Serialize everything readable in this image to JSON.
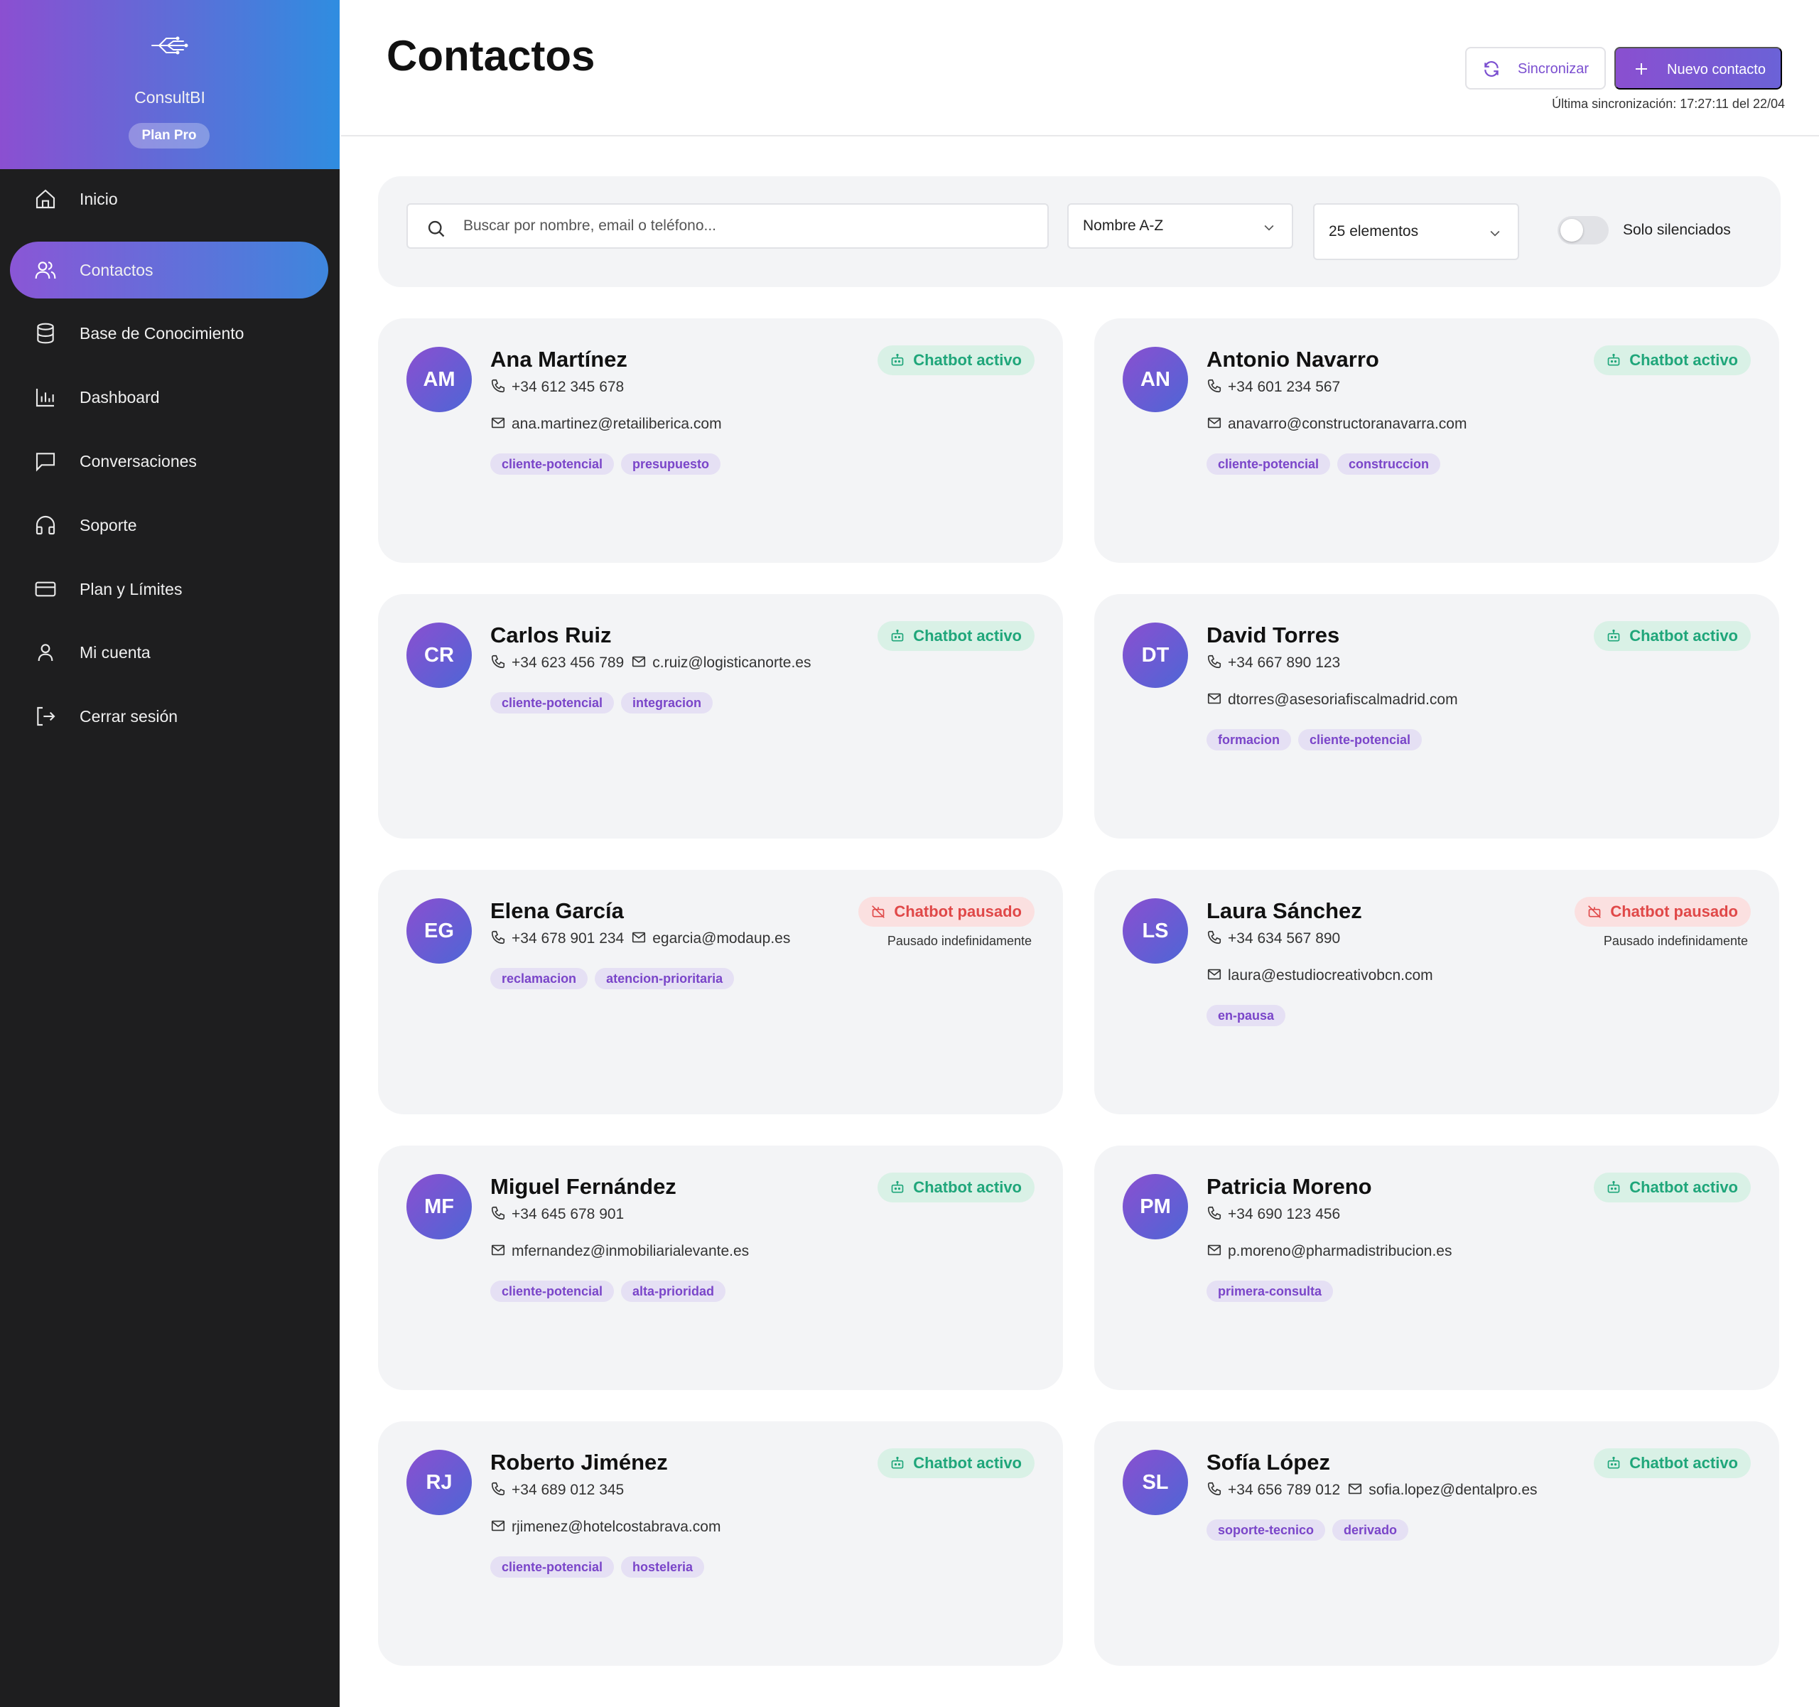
{
  "brand": {
    "name": "ConsultBI",
    "plan": "Plan Pro"
  },
  "nav": [
    {
      "label": "Inicio",
      "icon": "home-icon"
    },
    {
      "label": "Contactos",
      "icon": "users-icon"
    },
    {
      "label": "Base de Conocimiento",
      "icon": "database-icon"
    },
    {
      "label": "Dashboard",
      "icon": "bar-chart-icon"
    },
    {
      "label": "Conversaciones",
      "icon": "message-icon"
    },
    {
      "label": "Soporte",
      "icon": "headphones-icon"
    },
    {
      "label": "Plan y Límites",
      "icon": "credit-card-icon"
    },
    {
      "label": "Mi cuenta",
      "icon": "user-icon"
    },
    {
      "label": "Cerrar sesión",
      "icon": "logout-icon"
    }
  ],
  "header": {
    "title": "Contactos",
    "sync_label": "Sincronizar",
    "new_label": "Nuevo contacto",
    "last_sync": "Última sincronización: 17:27:11 del 22/04"
  },
  "filters": {
    "search_placeholder": "Buscar por nombre, email o teléfono...",
    "sort": "Nombre A-Z",
    "page_size": "25 elementos",
    "muted_label": "Solo silenciados"
  },
  "status_labels": {
    "active": "Chatbot activo",
    "paused": "Chatbot pausado"
  },
  "colors": {
    "accent": "#7b4fd0",
    "active": "#1fa67a",
    "paused": "#e04848",
    "sidebar": "#1e1e1f"
  },
  "contacts": [
    {
      "initials": "AM",
      "name": "Ana Martínez",
      "phone": "+34 612 345 678",
      "email": "ana.martinez@retailiberica.com",
      "inline": false,
      "status": "Chatbot activo",
      "state": "active",
      "note": "",
      "tags": [
        "cliente-potencial",
        "presupuesto"
      ]
    },
    {
      "initials": "AN",
      "name": "Antonio Navarro",
      "phone": "+34 601 234 567",
      "email": "anavarro@constructoranavarra.com",
      "inline": false,
      "status": "Chatbot activo",
      "state": "active",
      "note": "",
      "tags": [
        "cliente-potencial",
        "construccion"
      ]
    },
    {
      "initials": "CR",
      "name": "Carlos Ruiz",
      "phone": "+34 623 456 789",
      "email": "c.ruiz@logisticanorte.es",
      "inline": true,
      "status": "Chatbot activo",
      "state": "active",
      "note": "",
      "tags": [
        "cliente-potencial",
        "integracion"
      ]
    },
    {
      "initials": "DT",
      "name": "David Torres",
      "phone": "+34 667 890 123",
      "email": "dtorres@asesoriafiscalmadrid.com",
      "inline": false,
      "status": "Chatbot activo",
      "state": "active",
      "note": "",
      "tags": [
        "formacion",
        "cliente-potencial"
      ]
    },
    {
      "initials": "EG",
      "name": "Elena García",
      "phone": "+34 678 901 234",
      "email": "egarcia@modaup.es",
      "inline": true,
      "status": "Chatbot pausado",
      "state": "paused",
      "note": "Pausado indefinidamente",
      "tags": [
        "reclamacion",
        "atencion-prioritaria"
      ]
    },
    {
      "initials": "LS",
      "name": "Laura Sánchez",
      "phone": "+34 634 567 890",
      "email": "laura@estudiocreativobcn.com",
      "inline": false,
      "status": "Chatbot pausado",
      "state": "paused",
      "note": "Pausado indefinidamente",
      "tags": [
        "en-pausa"
      ]
    },
    {
      "initials": "MF",
      "name": "Miguel Fernández",
      "phone": "+34 645 678 901",
      "email": "mfernandez@inmobiliarialevante.es",
      "inline": false,
      "status": "Chatbot activo",
      "state": "active",
      "note": "",
      "tags": [
        "cliente-potencial",
        "alta-prioridad"
      ]
    },
    {
      "initials": "PM",
      "name": "Patricia Moreno",
      "phone": "+34 690 123 456",
      "email": "p.moreno@pharmadistribucion.es",
      "inline": false,
      "status": "Chatbot activo",
      "state": "active",
      "note": "",
      "tags": [
        "primera-consulta"
      ]
    },
    {
      "initials": "RJ",
      "name": "Roberto Jiménez",
      "phone": "+34 689 012 345",
      "email": "rjimenez@hotelcostabrava.com",
      "inline": false,
      "status": "Chatbot activo",
      "state": "active",
      "note": "",
      "tags": [
        "cliente-potencial",
        "hosteleria"
      ]
    },
    {
      "initials": "SL",
      "name": "Sofía López",
      "phone": "+34 656 789 012",
      "email": "sofia.lopez@dentalpro.es",
      "inline": true,
      "status": "Chatbot activo",
      "state": "active",
      "note": "",
      "tags": [
        "soporte-tecnico",
        "derivado"
      ]
    }
  ]
}
